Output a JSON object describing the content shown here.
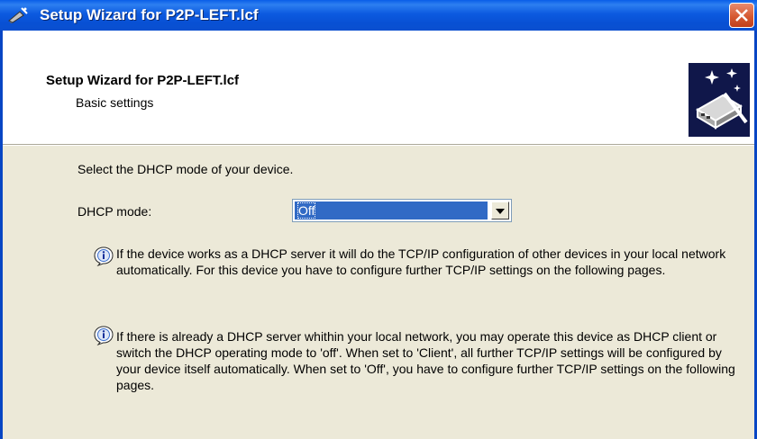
{
  "window": {
    "title": "Setup Wizard for P2P-LEFT.lcf"
  },
  "header": {
    "title": "Setup Wizard for P2P-LEFT.lcf",
    "subtitle": "Basic settings"
  },
  "content": {
    "prompt": "Select the DHCP mode of your device.",
    "dhcp_label": "DHCP mode:",
    "dhcp_value": "Off",
    "info1": "If the device works as a DHCP server it will do the TCP/IP configuration of other devices in your local network automatically. For this device you have to configure further TCP/IP settings on the following pages.",
    "info2": "If there is already a DHCP server whithin your local network, you may operate this device as DHCP client or switch the DHCP operating mode to 'off'. When set to 'Client', all further TCP/IP settings will be configured by your device itself automatically. When set to 'Off', you have to configure further TCP/IP settings on the following pages."
  },
  "icons": {
    "title_icon": "wizard-wand-icon",
    "close": "close-icon",
    "header_logo": "wizard-device-icon",
    "info": "info-icon",
    "dropdown": "chevron-down-icon"
  },
  "colors": {
    "titlebar": "#0a5ee8",
    "face": "#ece9d8",
    "selection": "#316ac5",
    "close": "#d65a33"
  }
}
